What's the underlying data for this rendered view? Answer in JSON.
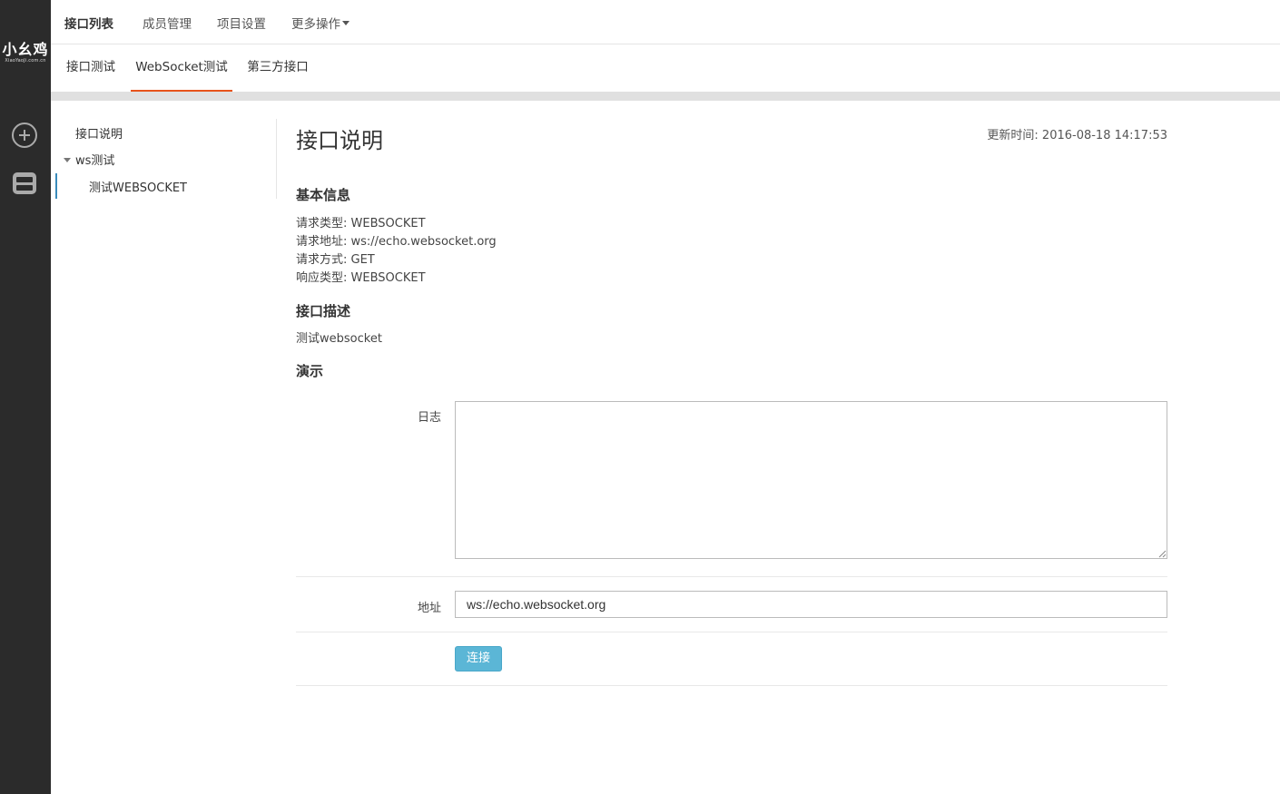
{
  "brand": {
    "logo_text": "小幺鸡",
    "logo_sub": "XiaoYaoJi.com.cn"
  },
  "rail": {
    "icons": [
      "plus-circle-icon",
      "storage-box-icon"
    ]
  },
  "topnav": {
    "items": [
      {
        "label": "接口列表"
      },
      {
        "label": "成员管理"
      },
      {
        "label": "项目设置"
      },
      {
        "label": "更多操作"
      }
    ]
  },
  "subnav": {
    "tabs": [
      {
        "label": "接口测试"
      },
      {
        "label": "WebSocket测试"
      },
      {
        "label": "第三方接口"
      }
    ],
    "active_index": 1,
    "accent_color": "#e8531c"
  },
  "tree": {
    "root": "接口说明",
    "folder": "ws测试",
    "leaf": "测试WEBSOCKET",
    "active_color": "#3a8bbb"
  },
  "content": {
    "title": "接口说明",
    "updated": "更新时间: 2016-08-18 14:17:53",
    "basic_info_heading": "基本信息",
    "basic_info": [
      "请求类型: WEBSOCKET",
      "请求地址: ws://echo.websocket.org",
      "请求方式: GET",
      "响应类型: WEBSOCKET"
    ],
    "desc_heading": "接口描述",
    "desc_text": "测试websocket",
    "demo_heading": "演示"
  },
  "demo": {
    "log_label": "日志",
    "log_value": "",
    "address_label": "地址",
    "address_value": "ws://echo.websocket.org",
    "connect_label": "连接",
    "button_color": "#5bb6d6"
  }
}
